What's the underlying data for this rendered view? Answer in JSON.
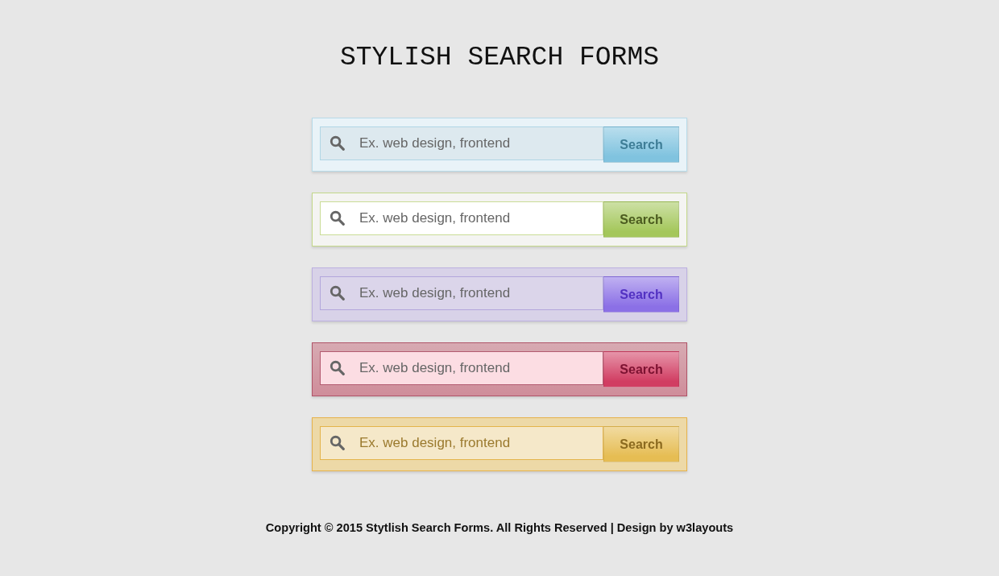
{
  "title": "STYLISH SEARCH FORMS",
  "forms": [
    {
      "placeholder": "Ex. web design, frontend",
      "button": "Search",
      "color": "#80c3df"
    },
    {
      "placeholder": "Ex. web design, frontend",
      "button": "Search",
      "color": "#a4c75b"
    },
    {
      "placeholder": "Ex. web design, frontend",
      "button": "Search",
      "color": "#8b70e6"
    },
    {
      "placeholder": "Ex. web design, frontend",
      "button": "Search",
      "color": "#d13d62"
    },
    {
      "placeholder": "Ex. web design, frontend",
      "button": "Search",
      "color": "#e6bd53"
    }
  ],
  "footer": "Copyright © 2015 Stytlish Search Forms. All Rights Reserved | Design by w3layouts"
}
